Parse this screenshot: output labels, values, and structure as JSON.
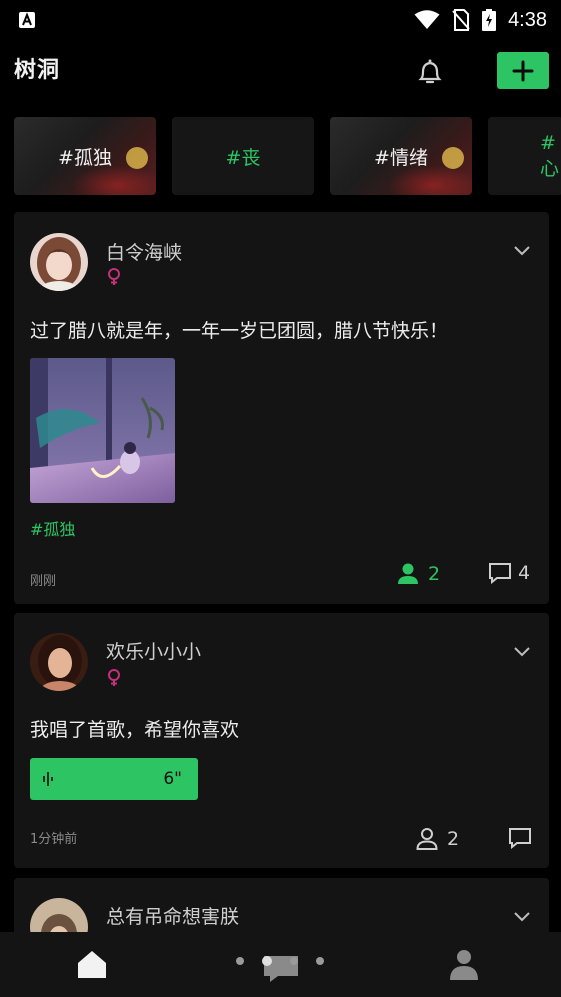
{
  "status_bar": {
    "time": "4:38",
    "colors": {
      "text": "#ffffff"
    }
  },
  "header": {
    "title": "树洞",
    "bell_icon": "bell-icon",
    "add_icon": "plus-icon",
    "accent": "#2dc463"
  },
  "topics": [
    {
      "label": "#孤独",
      "style": "image"
    },
    {
      "label": "#丧",
      "style": "plain"
    },
    {
      "label": "#情绪",
      "style": "image"
    },
    {
      "label": "#心",
      "style": "plain"
    }
  ],
  "posts": [
    {
      "username": "白令海峡",
      "gender_icon": "female-icon",
      "text": "过了腊八就是年，一年一岁已团圆，腊八节快乐！",
      "tag": "#孤独",
      "time": "刚刚",
      "likes": "2",
      "comments": "4",
      "liked": true
    },
    {
      "username": "欢乐小小小",
      "gender_icon": "female-icon",
      "text": "我唱了首歌，希望你喜欢",
      "voice_duration": "6\"",
      "time": "1分钟前",
      "likes": "2",
      "comments": "",
      "liked": false
    },
    {
      "username": "总有吊命想害朕",
      "gender_icon": "female-icon"
    }
  ],
  "bottom_nav": {
    "items": [
      "home-icon",
      "message-icon",
      "profile-icon"
    ],
    "active": "home-icon",
    "pager_active_index": 1,
    "pager_count": 4
  }
}
